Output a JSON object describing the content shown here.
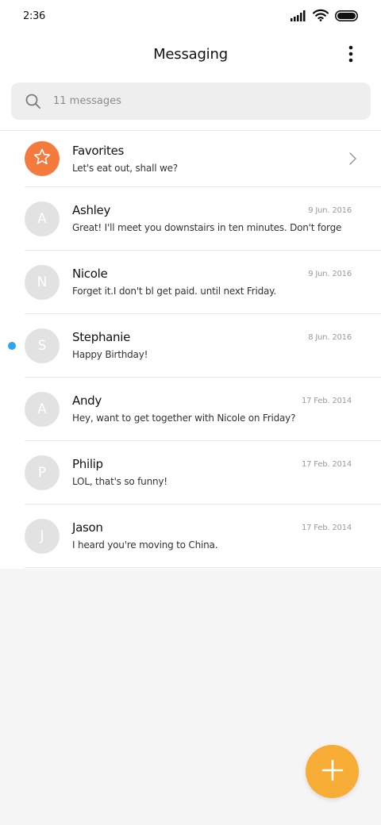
{
  "status_bar": {
    "time": "2:36"
  },
  "header": {
    "title": "Messaging"
  },
  "search": {
    "placeholder": "11 messages"
  },
  "favorites": {
    "name": "Favorites",
    "preview": "Let's eat out, shall we?"
  },
  "conversations": [
    {
      "initial": "A",
      "name": "Ashley",
      "preview": "Great! I'll meet you downstairs in ten minutes. Don't forge",
      "date": "9 Jun. 2016",
      "unread": false
    },
    {
      "initial": "N",
      "name": "Nicole",
      "preview": "Forget it.I don't bl get paid. until next Friday.",
      "date": "9 Jun. 2016",
      "unread": false
    },
    {
      "initial": "S",
      "name": "Stephanie",
      "preview": "Happy Birthday!",
      "date": "8 Jun. 2016",
      "unread": true
    },
    {
      "initial": "A",
      "name": "Andy",
      "preview": "Hey, want to get together with Nicole on Friday?",
      "date": "17 Feb. 2014",
      "unread": false
    },
    {
      "initial": "P",
      "name": "Philip",
      "preview": "LOL, that's so funny!",
      "date": "17 Feb. 2014",
      "unread": false
    },
    {
      "initial": "J",
      "name": "Jason",
      "preview": "I heard you're moving to China.",
      "date": "17 Feb. 2014",
      "unread": false
    }
  ],
  "colors": {
    "favorites_avatar": "#f47a3d",
    "fab": "#f6ac35",
    "unread_dot": "#2aa6ee",
    "avatar_default": "#e2e2e2"
  },
  "icons": {
    "signal": "signal-icon",
    "wifi": "wifi-icon",
    "battery": "battery-icon",
    "more": "more-vertical-icon",
    "search": "search-icon",
    "star": "star-icon",
    "chevron": "chevron-right-icon",
    "add": "plus-icon"
  }
}
